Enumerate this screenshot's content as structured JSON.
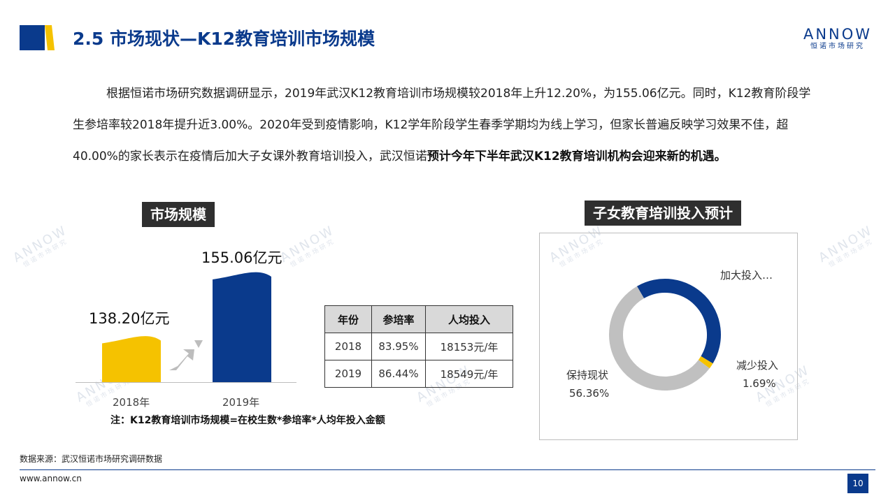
{
  "header": {
    "title": "2.5 市场现状—K12教育培训市场规模",
    "logo_text": "ANNOW",
    "logo_sub": "恒诺市场研究",
    "colors": {
      "brand_blue": "#0a3a8c",
      "accent_yellow": "#f5c200"
    }
  },
  "paragraph": {
    "normal_part": "根据恒诺市场研究数据调研显示，2019年武汉K12教育培训市场规模较2018年上升12.20%，为155.06亿元。同时，K12教育阶段学生参培率较2018年提升近3.00%。2020年受到疫情影响，K12学年阶段学生春季学期均为线上学习，但家长普遍反映学习效果不佳，超40.00%的家长表示在疫情后加大子女课外教育培训投入，武汉恒诺",
    "bold_part": "预计今年下半年武汉K12教育培训机构会迎来新的机遇。"
  },
  "market_section": {
    "label": "市场规模",
    "table": {
      "headers": [
        "年份",
        "参培率",
        "人均投入"
      ],
      "rows": [
        [
          "2018",
          "83.95%",
          "18153元/年"
        ],
        [
          "2019",
          "86.44%",
          "18549元/年"
        ]
      ]
    },
    "note": "注：K12教育培训市场规模=在校生数*参培率*人均年投入金额"
  },
  "invest_section": {
    "label": "子女教育培训投入预计"
  },
  "chart_data": [
    {
      "type": "bar",
      "categories": [
        "2018年",
        "2019年"
      ],
      "values": [
        138.2,
        155.06
      ],
      "data_labels": [
        "138.20亿元",
        "155.06亿元"
      ],
      "colors": [
        "#f5c200",
        "#0a3a8c"
      ]
    },
    {
      "type": "pie",
      "style": "donut",
      "slices": [
        {
          "label": "加大投入…",
          "value": 41.95,
          "value_label": "",
          "color": "#0a3a8c"
        },
        {
          "label": "减少投入",
          "value": 1.69,
          "value_label": "1.69%",
          "color": "#f5c200"
        },
        {
          "label": "保持现状",
          "value": 56.36,
          "value_label": "56.36%",
          "color": "#c0c0c0"
        }
      ]
    }
  ],
  "footer": {
    "source": "数据来源：武汉恒诺市场研究调研数据",
    "website": "www.annow.cn",
    "page": "10"
  }
}
